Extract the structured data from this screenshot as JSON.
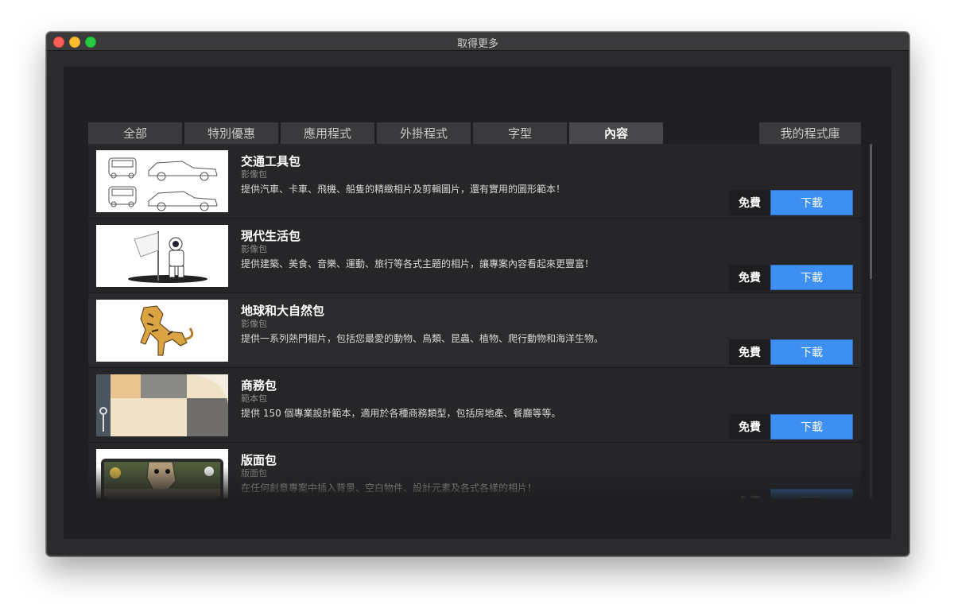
{
  "window": {
    "title": "取得更多"
  },
  "tabs": [
    {
      "label": "全部"
    },
    {
      "label": "特別優惠"
    },
    {
      "label": "應用程式"
    },
    {
      "label": "外掛程式"
    },
    {
      "label": "字型"
    },
    {
      "label": "內容",
      "active": true
    }
  ],
  "library_tab": {
    "label": "我的程式庫"
  },
  "items": [
    {
      "title": "交通工具包",
      "subtitle": "影像包",
      "description": "提供汽車、卡車、飛機、船隻的精緻相片及剪輯圖片，還有實用的圖形範本！",
      "price": "免費",
      "action": "下載",
      "thumb_icon": "cars-icon"
    },
    {
      "title": "現代生活包",
      "subtitle": "影像包",
      "description": "提供建築、美食、音樂、運動、旅行等各式主題的相片，讓專案內容看起來更豐富！",
      "price": "免費",
      "action": "下載",
      "thumb_icon": "astronaut-icon"
    },
    {
      "title": "地球和大自然包",
      "subtitle": "影像包",
      "description": "提供一系列熱門相片，包括您最愛的動物、鳥類、昆蟲、植物、爬行動物和海洋生物。",
      "price": "免費",
      "action": "下載",
      "thumb_icon": "tiger-icon"
    },
    {
      "title": "商務包",
      "subtitle": "範本包",
      "description": "提供 150 個專業設計範本，適用於各種商務類型，包括房地產、餐廳等等。",
      "price": "免費",
      "action": "下載",
      "thumb_icon": "business-template-icon"
    },
    {
      "title": "版面包",
      "subtitle": "版面包",
      "description": "在任何創意專案中插入背景、空白物件、設計元素及各式各樣的相片！",
      "price": "免費",
      "action": "下載",
      "thumb_icon": "layout-dino-icon"
    }
  ],
  "colors": {
    "accent": "#3d8ff2",
    "panel": "#1f1f21",
    "row": "#262628"
  }
}
